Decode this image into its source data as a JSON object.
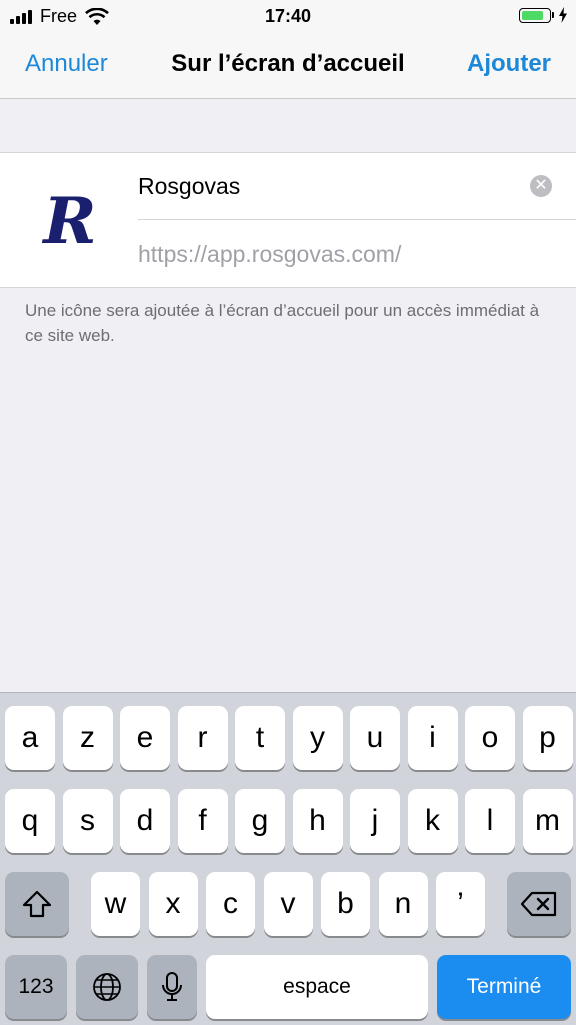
{
  "status_bar": {
    "carrier": "Free",
    "time": "17:40",
    "battery_level": 0.85,
    "charging": true
  },
  "nav": {
    "cancel_label": "Annuler",
    "title": "Sur l’écran d’accueil",
    "add_label": "Ajouter"
  },
  "bookmark": {
    "icon_letter": "R",
    "name_value": "Rosgovas",
    "url": "https://app.rosgovas.com/"
  },
  "footnote": "Une icône sera ajoutée à l’écran d’accueil pour un accès immédiat à ce site web.",
  "keyboard": {
    "row1": [
      "a",
      "z",
      "e",
      "r",
      "t",
      "y",
      "u",
      "i",
      "o",
      "p"
    ],
    "row2": [
      "q",
      "s",
      "d",
      "f",
      "g",
      "h",
      "j",
      "k",
      "l",
      "m"
    ],
    "row3": [
      "w",
      "x",
      "c",
      "v",
      "b",
      "n",
      "’"
    ],
    "numbers_label": "123",
    "space_label": "espace",
    "done_label": "Terminé"
  },
  "colors": {
    "accent": "#1e88d8",
    "done_key": "#1b8cf0",
    "battery": "#4cd964",
    "icon_letter": "#1a1f6e"
  }
}
